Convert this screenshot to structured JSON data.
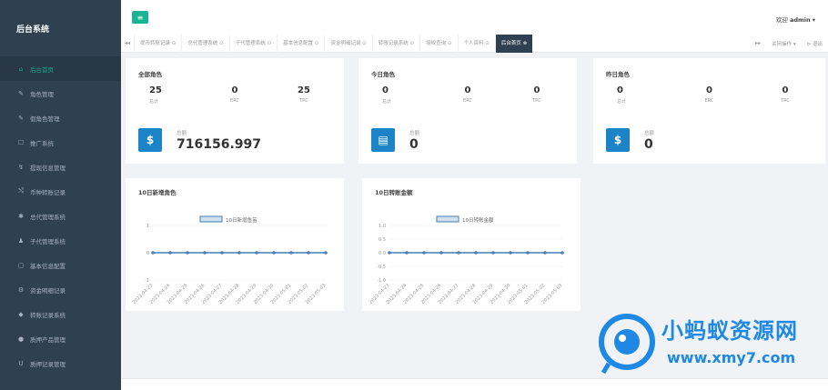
{
  "app": {
    "title": "后台系统",
    "welcome": "欢迎",
    "user": "admin",
    "user_caret": "▾"
  },
  "sidebar": {
    "items": [
      {
        "label": "后台首页",
        "icon": "home-icon",
        "glyph": "⌂"
      },
      {
        "label": "角色管理",
        "icon": "wrench-icon",
        "glyph": "✎"
      },
      {
        "label": "假角色管理",
        "icon": "wrench-icon",
        "glyph": "✎"
      },
      {
        "label": "推广系统",
        "icon": "edit-icon",
        "glyph": "☐"
      },
      {
        "label": "提现信息管理",
        "icon": "signal-icon",
        "glyph": "↯"
      },
      {
        "label": "币种转账记录",
        "icon": "shuffle-icon",
        "glyph": "⤭"
      },
      {
        "label": "总代管理系统",
        "icon": "gear-icon",
        "glyph": "✱"
      },
      {
        "label": "子代管理系统",
        "icon": "users-icon",
        "glyph": "♟"
      },
      {
        "label": "基本信息配置",
        "icon": "file-icon",
        "glyph": "▢"
      },
      {
        "label": "资金明细记录",
        "icon": "cogs-icon",
        "glyph": "⚙"
      },
      {
        "label": "转账记录系统",
        "icon": "car-icon",
        "glyph": "◆"
      },
      {
        "label": "质押产品管理",
        "icon": "comment-icon",
        "glyph": "●"
      },
      {
        "label": "质押记录管理",
        "icon": "magnet-icon",
        "glyph": "U"
      }
    ]
  },
  "tabs": {
    "prev": "◂◂",
    "next": "▸▸",
    "items": [
      "提币转账记录 ⊙",
      "总代管理系统 ⊙",
      "子代管理系统 ⊙",
      "基本信息配置 ⊙",
      "资金明细记录 ⊙",
      "转账记录系统 ⊙",
      "授权查询 ⊙",
      "个人资料 ⊙",
      "后台首页 ⊗"
    ],
    "close_ops": "关闭操作 ▾",
    "logout": "⊳ 退出"
  },
  "panels": [
    {
      "title": "全部角色",
      "stats": [
        {
          "value": "25",
          "label": "总计"
        },
        {
          "value": "0",
          "label": "ERC"
        },
        {
          "value": "25",
          "label": "TRC"
        }
      ],
      "money_label": "总额",
      "money_value": "716156.997",
      "money_icon": "$"
    },
    {
      "title": "今日角色",
      "stats": [
        {
          "value": "0",
          "label": "总计"
        },
        {
          "value": "0",
          "label": "ERC"
        },
        {
          "value": "0",
          "label": "TRC"
        }
      ],
      "money_label": "总额",
      "money_value": "0",
      "money_icon": "▤"
    },
    {
      "title": "昨日角色",
      "stats": [
        {
          "value": "0",
          "label": "总计"
        },
        {
          "value": "0",
          "label": "ERC"
        },
        {
          "value": "0",
          "label": "TRC"
        }
      ],
      "money_label": "总额",
      "money_value": "0",
      "money_icon": "$"
    }
  ],
  "chart_data": [
    {
      "type": "line",
      "title": "10日新增角色",
      "series": [
        {
          "name": "10日新增鱼苗",
          "values": [
            0,
            0,
            0,
            0,
            0,
            0,
            0,
            0,
            0,
            0,
            0
          ]
        }
      ],
      "x": [
        "2023-04-23",
        "2023-04-24",
        "2023-04-25",
        "2023-04-26",
        "2023-04-27",
        "2023-04-28",
        "2023-04-29",
        "2023-04-30",
        "2023-05-01",
        "2023-05-02",
        "2023-05-03"
      ],
      "yticks": [
        1,
        0,
        -1
      ],
      "ylim": [
        -1,
        1
      ],
      "color": "#4a7eb3"
    },
    {
      "type": "line",
      "title": "10日转账金额",
      "series": [
        {
          "name": "10日转账金额",
          "values": [
            0,
            0,
            0,
            0,
            0,
            0,
            0,
            0,
            0,
            0,
            0
          ]
        }
      ],
      "x": [
        "2023-04-23",
        "2023-04-24",
        "2023-04-25",
        "2023-04-26",
        "2023-04-27",
        "2023-04-28",
        "2023-04-29",
        "2023-04-30",
        "2023-05-01",
        "2023-05-02",
        "2023-05-03"
      ],
      "yticks": [
        1.0,
        0.5,
        0,
        -0.5,
        -1.0
      ],
      "ylim": [
        -1,
        1
      ],
      "color": "#4a7eb3"
    }
  ],
  "watermark": {
    "title": "小蚂蚁资源网",
    "url": "www.xmy7.com"
  },
  "colors": {
    "accent": "#1ab394",
    "sidebar": "#2f4050",
    "money_box": "#1c84c6"
  }
}
